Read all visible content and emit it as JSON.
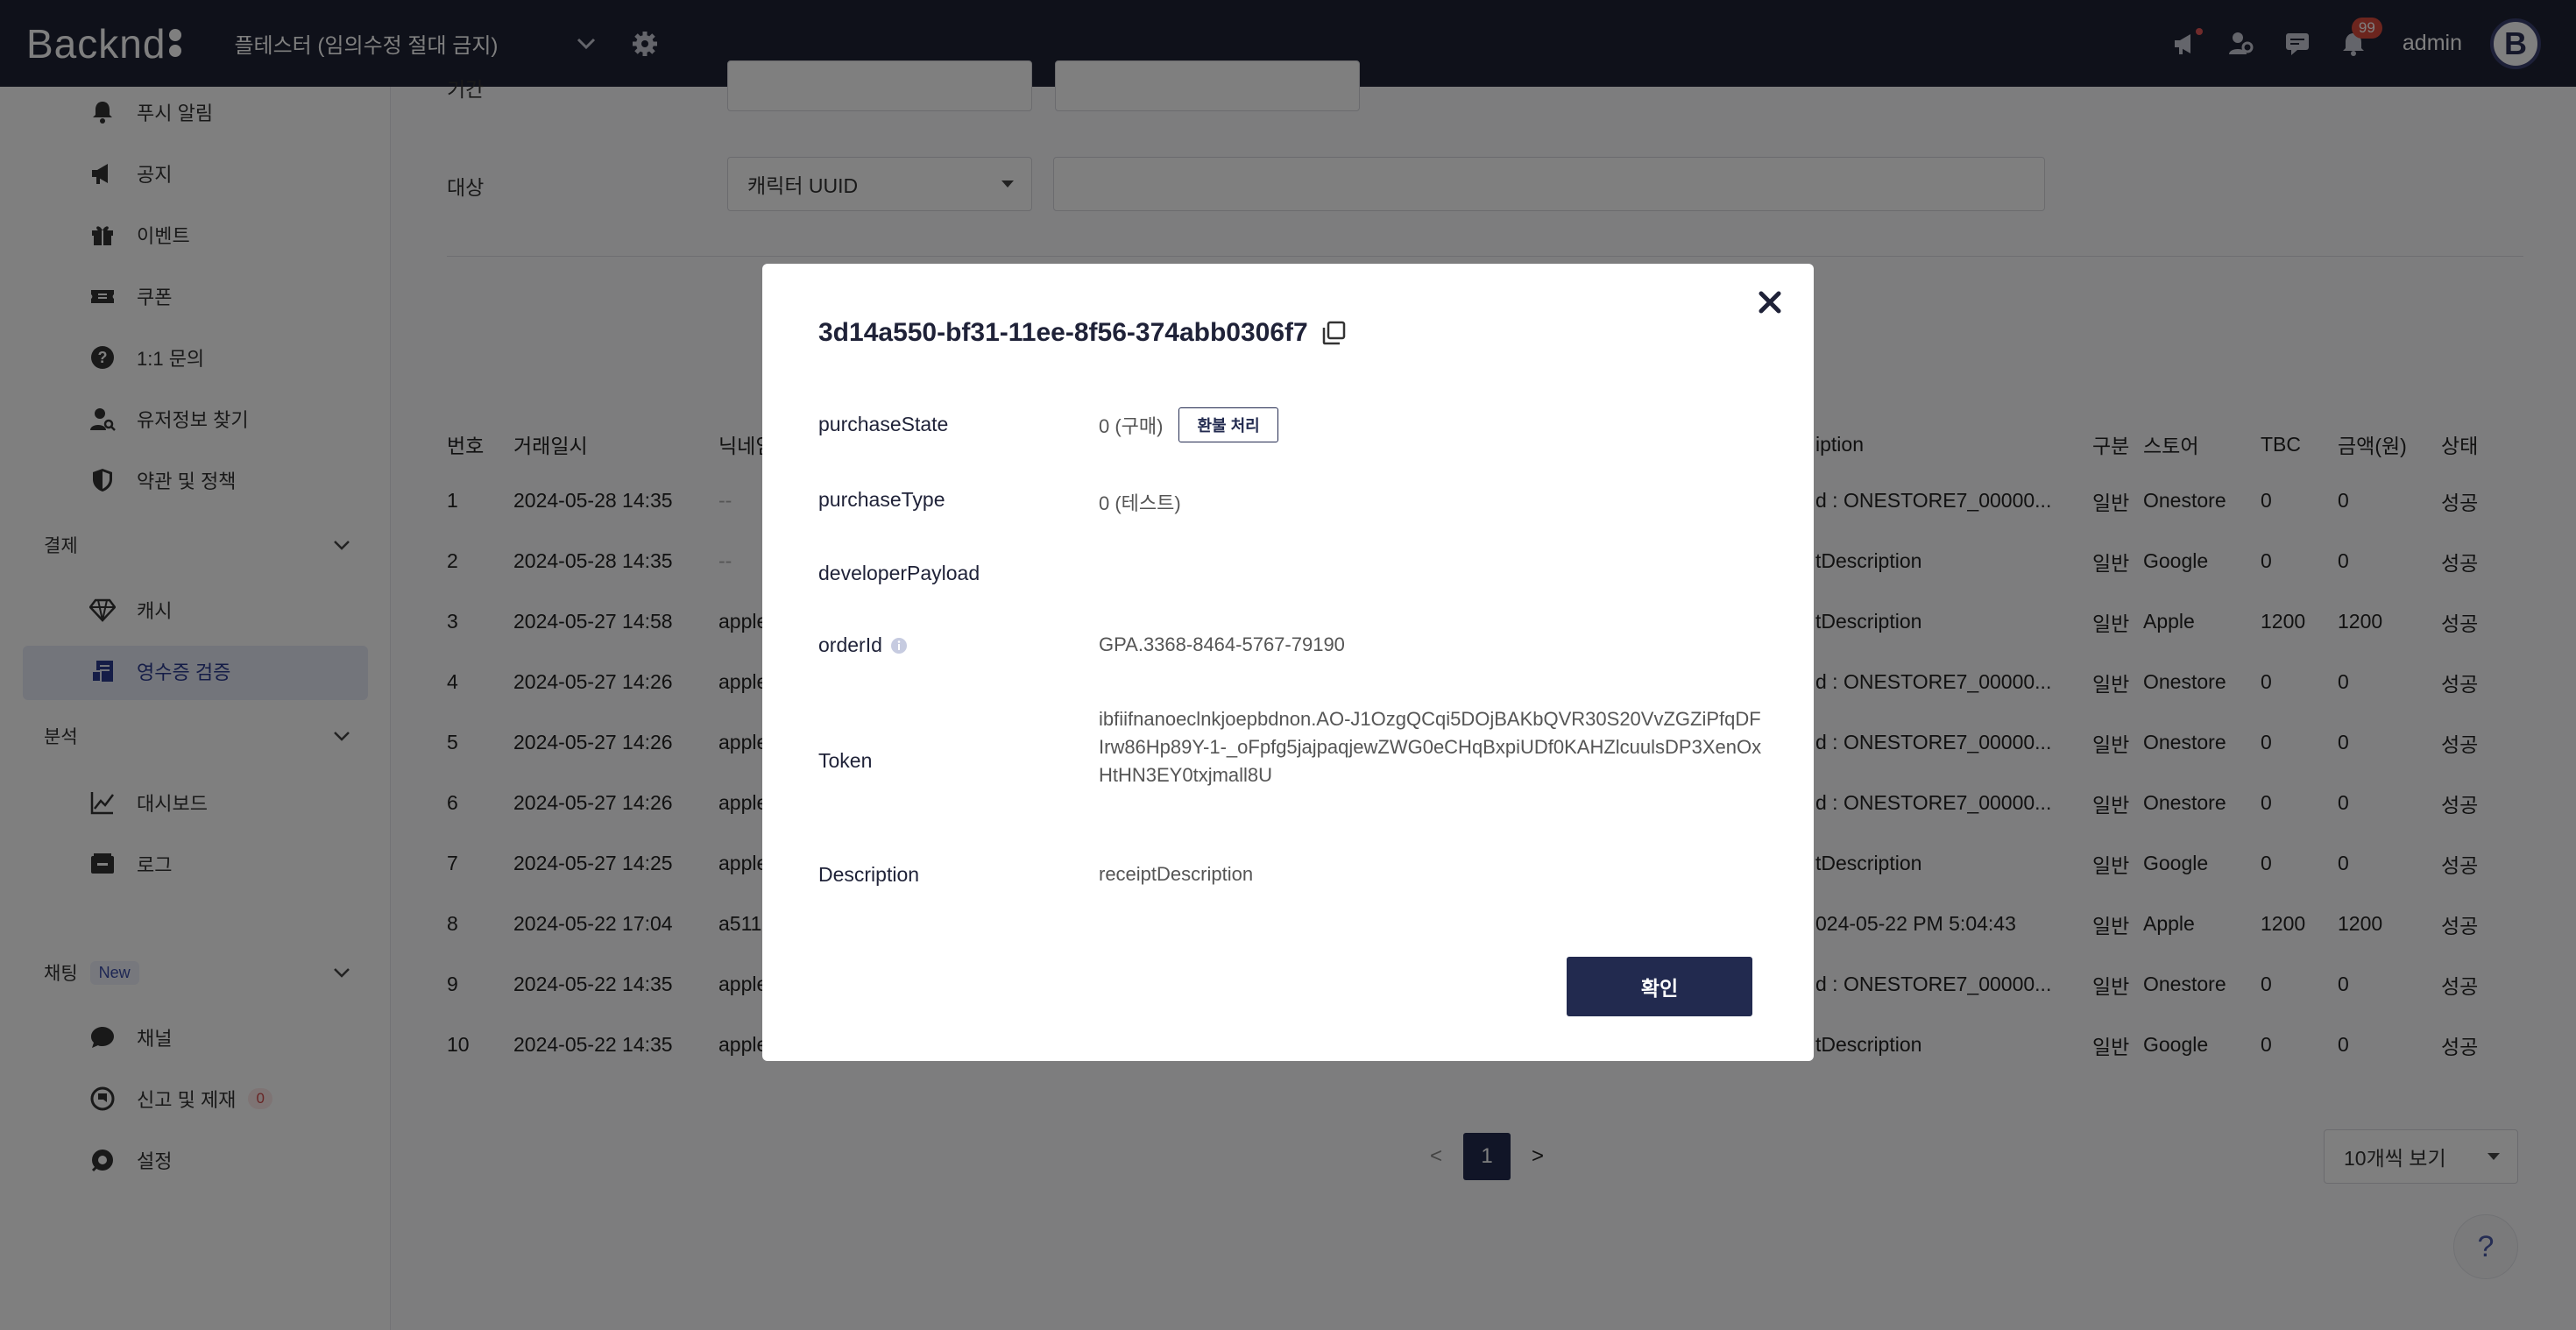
{
  "topbar": {
    "logo": "Backnd",
    "project_name": "플테스터 (임의수정 절대 금지)",
    "notification_count": "99",
    "user_name": "admin",
    "avatar_letter": "B"
  },
  "sidebar": {
    "items_top": [
      {
        "label": "푸시 알림",
        "icon": "bell-icon"
      },
      {
        "label": "공지",
        "icon": "megaphone-icon"
      },
      {
        "label": "이벤트",
        "icon": "gift-icon"
      },
      {
        "label": "쿠폰",
        "icon": "ticket-icon"
      },
      {
        "label": "1:1 문의",
        "icon": "question-icon"
      },
      {
        "label": "유저정보 찾기",
        "icon": "user-search-icon"
      },
      {
        "label": "약관 및 정책",
        "icon": "shield-icon"
      }
    ],
    "group_payment": "결제",
    "payment_items": [
      {
        "label": "캐시",
        "icon": "diamond-icon"
      },
      {
        "label": "영수증 검증",
        "icon": "receipt-icon"
      }
    ],
    "group_analytics": "분석",
    "analytics_items": [
      {
        "label": "대시보드",
        "icon": "chart-icon"
      },
      {
        "label": "로그",
        "icon": "log-icon"
      }
    ],
    "group_chat": "채팅",
    "chat_new_badge": "New",
    "chat_items": [
      {
        "label": "채널",
        "icon": "chat-bubble-icon"
      },
      {
        "label": "신고 및 제재",
        "icon": "report-icon",
        "badge": "0"
      },
      {
        "label": "설정",
        "icon": "settings-icon"
      }
    ]
  },
  "filters": {
    "target_label": "대상",
    "target_select": "캐릭터 UUID",
    "top_label_partial": "기간"
  },
  "table": {
    "headers": [
      "번호",
      "거래일시",
      "닉네임",
      "iption",
      "구분",
      "스토어",
      "TBC",
      "금액(원)",
      "상태"
    ],
    "rows": [
      [
        "1",
        "2024-05-28 14:35",
        "--",
        "d : ONESTORE7_00000...",
        "일반",
        "Onestore",
        "0",
        "0",
        "성공"
      ],
      [
        "2",
        "2024-05-28 14:35",
        "--",
        "tDescription",
        "일반",
        "Google",
        "0",
        "0",
        "성공"
      ],
      [
        "3",
        "2024-05-27 14:58",
        "apple",
        "tDescription",
        "일반",
        "Apple",
        "1200",
        "1200",
        "성공"
      ],
      [
        "4",
        "2024-05-27 14:26",
        "apple",
        "d : ONESTORE7_00000...",
        "일반",
        "Onestore",
        "0",
        "0",
        "성공"
      ],
      [
        "5",
        "2024-05-27 14:26",
        "apple",
        "d : ONESTORE7_00000...",
        "일반",
        "Onestore",
        "0",
        "0",
        "성공"
      ],
      [
        "6",
        "2024-05-27 14:26",
        "apple",
        "d : ONESTORE7_00000...",
        "일반",
        "Onestore",
        "0",
        "0",
        "성공"
      ],
      [
        "7",
        "2024-05-27 14:25",
        "apple",
        "tDescription",
        "일반",
        "Google",
        "0",
        "0",
        "성공"
      ],
      [
        "8",
        "2024-05-22 17:04",
        "a511",
        "024-05-22 PM 5:04:43",
        "일반",
        "Apple",
        "1200",
        "1200",
        "성공"
      ],
      [
        "9",
        "2024-05-22 14:35",
        "apple",
        "d : ONESTORE7_00000...",
        "일반",
        "Onestore",
        "0",
        "0",
        "성공"
      ],
      [
        "10",
        "2024-05-22 14:35",
        "apple",
        "tDescription",
        "일반",
        "Google",
        "0",
        "0",
        "성공"
      ]
    ]
  },
  "pagination": {
    "prev": "<",
    "current": "1",
    "next": ">",
    "per_page": "10개씩 보기"
  },
  "help": "?",
  "modal": {
    "title": "3d14a550-bf31-11ee-8f56-374abb0306f7",
    "fields": {
      "purchaseState_label": "purchaseState",
      "purchaseState_value": "0 (구매)",
      "refund_button": "환불 처리",
      "purchaseType_label": "purchaseType",
      "purchaseType_value": "0 (테스트)",
      "developerPayload_label": "developerPayload",
      "developerPayload_value": "",
      "orderId_label": "orderId",
      "orderId_value": "GPA.3368-8464-5767-79190",
      "token_label": "Token",
      "token_value": "ibfiifnanoeclnkjoepbdnon.AO-J1OzgQCqi5DOjBAKbQVR30S20VvZGZiPfqDFIrw86Hp89Y-1-_oFpfg5jajpaqjewZWG0eCHqBxpiUDf0KAHZlcuulsDP3XenOxHtHN3EY0txjmall8U",
      "description_label": "Description",
      "description_value": "receiptDescription"
    },
    "confirm_button": "확인"
  }
}
